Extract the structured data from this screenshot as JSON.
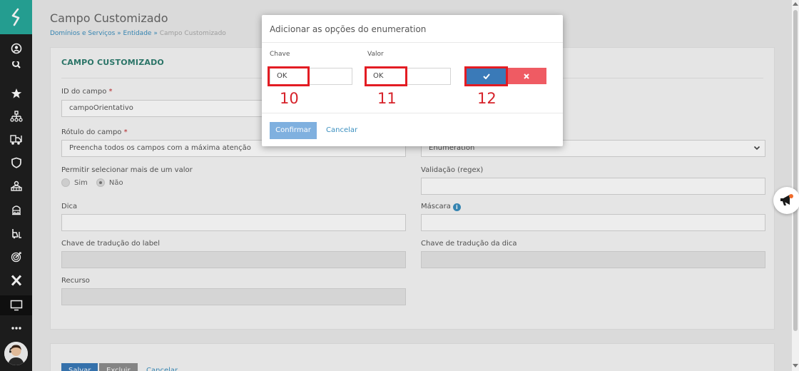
{
  "page": {
    "title": "Campo Customizado",
    "breadcrumb": [
      "Domínios e Serviços",
      "Entidade",
      "Campo Customizado"
    ]
  },
  "form": {
    "section_title": "CAMPO CUSTOMIZADO",
    "id_label": "ID do campo",
    "id_value": "campoOrientativo",
    "rotulo_label": "Rótulo do campo",
    "rotulo_value": "Preencha todos os campos com a máxima atenção",
    "tipo_value": "Enumeration",
    "multi_label": "Permitir selecionar mais de um valor",
    "multi_options": [
      "Sim",
      "Não"
    ],
    "multi_selected": "Não",
    "validacao_label": "Validação (regex)",
    "dica_label": "Dica",
    "mascara_label": "Máscara",
    "chave_label_label": "Chave de tradução do label",
    "chave_dica_label": "Chave de tradução da dica",
    "recurso_label": "Recurso",
    "required_mark": "*"
  },
  "footer": {
    "save": "Salvar",
    "delete": "Excluir",
    "cancel": "Cancelar"
  },
  "modal": {
    "title": "Adicionar as opções do enumeration",
    "chave_label": "Chave",
    "valor_label": "Valor",
    "chave_value": "OK",
    "valor_value": "OK",
    "confirm": "Confirmar",
    "cancel": "Cancelar",
    "annotations": [
      "10",
      "11",
      "12"
    ]
  },
  "colors": {
    "sidebar": "#1f1f1f",
    "logo": "#27a99b",
    "primary": "#3a7ab8",
    "danger": "#ef5b63",
    "highlight": "#e31c23"
  },
  "icons": [
    "logo-icon",
    "user-circle-icon",
    "search-icon",
    "star-icon",
    "hierarchy-icon",
    "truck-icon",
    "shield-icon",
    "people-icon",
    "car-icon",
    "forklift-icon",
    "target-icon",
    "x-icon",
    "monitor-icon",
    "more-icon",
    "megaphone-icon",
    "check-icon",
    "close-icon",
    "info-icon",
    "chevron-down-icon"
  ]
}
